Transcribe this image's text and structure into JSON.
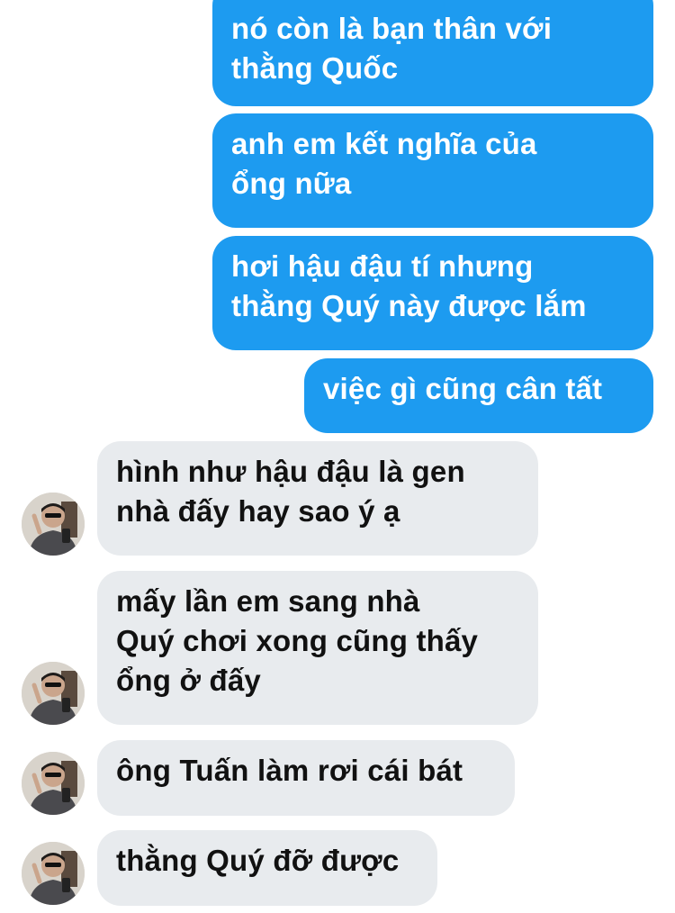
{
  "conversation": {
    "messages": [
      {
        "direction": "outgoing",
        "text": "nó còn là bạn thân với\nthằng Quốc"
      },
      {
        "direction": "outgoing",
        "text": "anh em kết nghĩa của\nổng nữa"
      },
      {
        "direction": "outgoing",
        "text": "hơi hậu đậu tí nhưng\nthằng Quý này được lắm"
      },
      {
        "direction": "outgoing",
        "text": "việc gì cũng cân tất"
      },
      {
        "direction": "incoming",
        "text": "hình như hậu đậu là gen\nnhà đấy hay sao ý ạ"
      },
      {
        "direction": "incoming",
        "text": "mấy lần em sang nhà\nQuý chơi xong cũng thấy\nổng ở đấy"
      },
      {
        "direction": "incoming",
        "text": "ông Tuấn làm rơi cái bát"
      },
      {
        "direction": "incoming",
        "text": "thằng Quý đỡ được"
      }
    ]
  },
  "colors": {
    "outgoing_bubble": "#1d9bf0",
    "incoming_bubble": "#e8ebee",
    "outgoing_text": "#ffffff",
    "incoming_text": "#111111"
  },
  "icons": {
    "avatar": "contact-avatar"
  }
}
